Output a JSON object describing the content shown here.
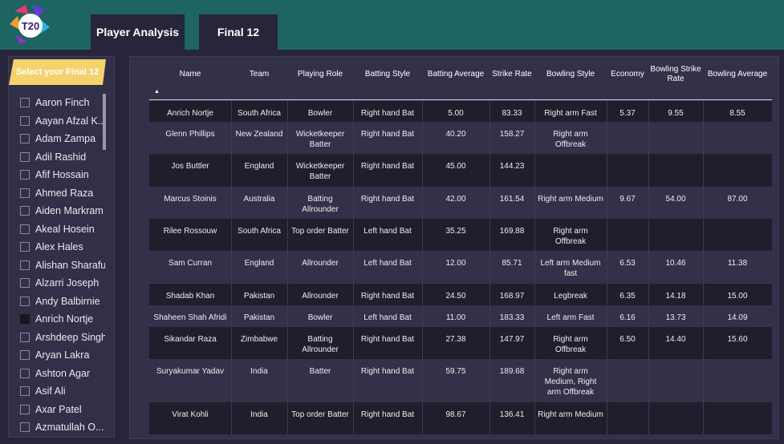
{
  "header": {
    "tabs": [
      {
        "label": "Player Analysis",
        "active": true
      },
      {
        "label": "Final 12",
        "active": false
      }
    ],
    "logo_text": "T20"
  },
  "sidebar": {
    "select_label": "Select your Final 12",
    "players": [
      {
        "name": "Aaron Finch",
        "checked": false
      },
      {
        "name": "Aayan Afzal K...",
        "checked": false
      },
      {
        "name": "Adam Zampa",
        "checked": false
      },
      {
        "name": "Adil Rashid",
        "checked": false
      },
      {
        "name": "Afif Hossain",
        "checked": false
      },
      {
        "name": "Ahmed Raza",
        "checked": false
      },
      {
        "name": "Aiden Markram",
        "checked": false
      },
      {
        "name": "Akeal Hosein",
        "checked": false
      },
      {
        "name": "Alex Hales",
        "checked": false
      },
      {
        "name": "Alishan Sharafu",
        "checked": false
      },
      {
        "name": "Alzarri Joseph",
        "checked": false
      },
      {
        "name": "Andy Balbirnie",
        "checked": false
      },
      {
        "name": "Anrich Nortje",
        "checked": true
      },
      {
        "name": "Arshdeep Singh",
        "checked": false
      },
      {
        "name": "Aryan Lakra",
        "checked": false
      },
      {
        "name": "Ashton Agar",
        "checked": false
      },
      {
        "name": "Asif Ali",
        "checked": false
      },
      {
        "name": "Axar Patel",
        "checked": false
      },
      {
        "name": "Azmatullah O...",
        "checked": false
      }
    ]
  },
  "table": {
    "columns": [
      "Name",
      "Team",
      "Playing Role",
      "Batting Style",
      "Batting Average",
      "Strike Rate",
      "Bowling Style",
      "Economy",
      "Bowling Strike Rate",
      "Bowling Average"
    ],
    "rows": [
      [
        "Anrich Nortje",
        "South Africa",
        "Bowler",
        "Right hand Bat",
        "5.00",
        "83.33",
        "Right arm Fast",
        "5.37",
        "9.55",
        "8.55"
      ],
      [
        "Glenn Phillips",
        "New Zealand",
        "Wicketkeeper Batter",
        "Right hand Bat",
        "40.20",
        "158.27",
        "Right arm Offbreak",
        "",
        "",
        ""
      ],
      [
        "Jos Buttler",
        "England",
        "Wicketkeeper Batter",
        "Right hand Bat",
        "45.00",
        "144.23",
        "",
        "",
        "",
        ""
      ],
      [
        "Marcus Stoinis",
        "Australia",
        "Batting Allrounder",
        "Right hand Bat",
        "42.00",
        "161.54",
        "Right arm Medium",
        "9.67",
        "54.00",
        "87.00"
      ],
      [
        "Rilee Rossouw",
        "South Africa",
        "Top order Batter",
        "Left hand Bat",
        "35.25",
        "169.88",
        "Right arm Offbreak",
        "",
        "",
        ""
      ],
      [
        "Sam Curran",
        "England",
        "Allrounder",
        "Left hand Bat",
        "12.00",
        "85.71",
        "Left arm Medium fast",
        "6.53",
        "10.46",
        "11.38"
      ],
      [
        "Shadab Khan",
        "Pakistan",
        "Allrounder",
        "Right hand Bat",
        "24.50",
        "168.97",
        "Legbreak",
        "6.35",
        "14.18",
        "15.00"
      ],
      [
        "Shaheen Shah Afridi",
        "Pakistan",
        "Bowler",
        "Left hand Bat",
        "11.00",
        "183.33",
        "Left arm Fast",
        "6.16",
        "13.73",
        "14.09"
      ],
      [
        "Sikandar Raza",
        "Zimbabwe",
        "Batting Allrounder",
        "Right hand Bat",
        "27.38",
        "147.97",
        "Right arm Offbreak",
        "6.50",
        "14.40",
        "15.60"
      ],
      [
        "Suryakumar Yadav",
        "India",
        "Batter",
        "Right hand Bat",
        "59.75",
        "189.68",
        "Right arm Medium, Right arm Offbreak",
        "",
        "",
        ""
      ],
      [
        "Virat Kohli",
        "India",
        "Top order Batter",
        "Right hand Bat",
        "98.67",
        "136.41",
        "Right arm Medium",
        "",
        "",
        ""
      ]
    ]
  },
  "colors": {
    "header_bg": "#1d6462",
    "page_bg": "#262539",
    "accent_yellow": "#f4d26e"
  }
}
